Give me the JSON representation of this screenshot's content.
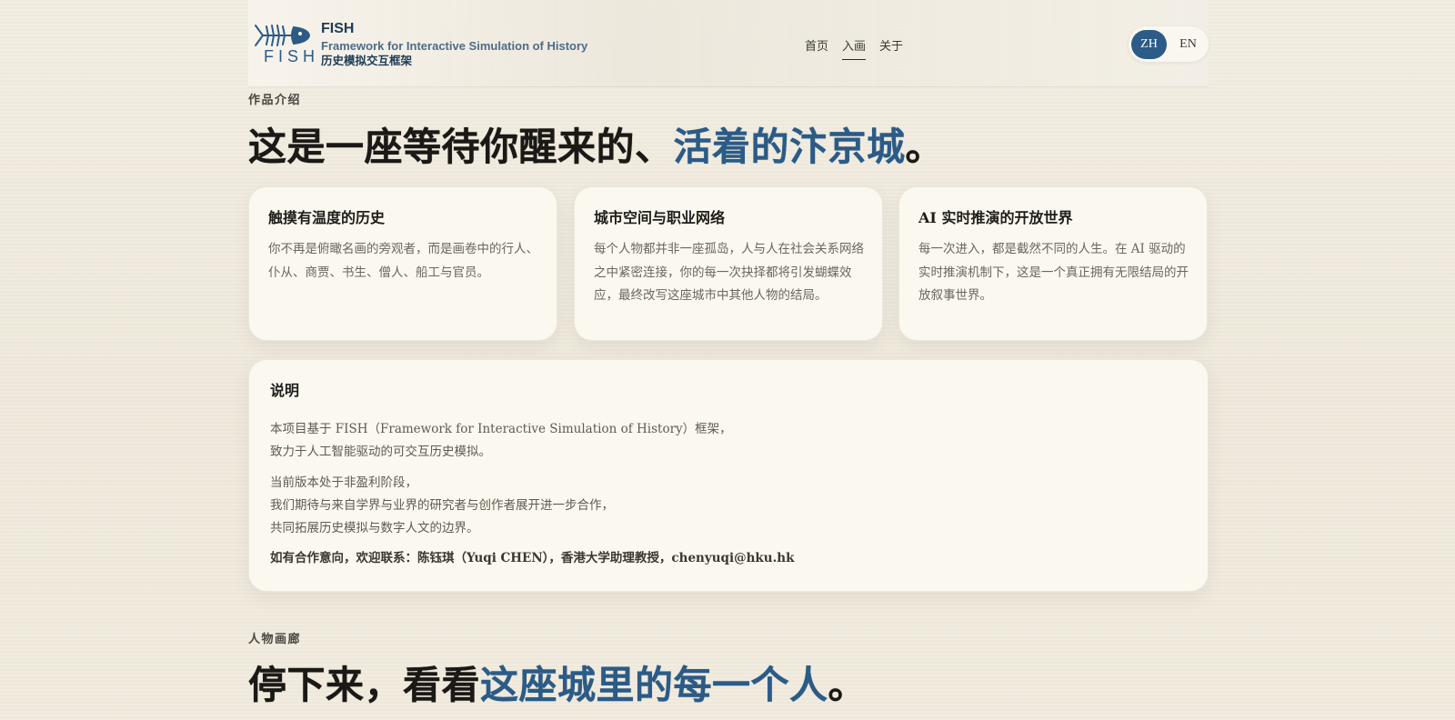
{
  "header": {
    "logo_text": "FISH",
    "brand_name": "FISH",
    "brand_subtitle": "Framework for Interactive Simulation of History",
    "brand_subtitle_cn": "历史模拟交互框架",
    "nav": [
      {
        "label": "首页",
        "active": false
      },
      {
        "label": "入画",
        "active": true
      },
      {
        "label": "关于",
        "active": false
      }
    ],
    "lang": {
      "zh": "ZH",
      "en": "EN",
      "selected": "ZH"
    }
  },
  "intro": {
    "section_label": "作品介绍",
    "headline_main": "这是一座等待你醒来的、",
    "headline_accent": "活着的汴京城",
    "headline_end": "。"
  },
  "cards": [
    {
      "title": "触摸有温度的历史",
      "text": "你不再是俯瞰名画的旁观者，而是画卷中的行人、仆从、商贾、书生、僧人、船工与官员。"
    },
    {
      "title": "城市空间与职业网络",
      "text": "每个人物都并非一座孤岛，人与人在社会关系网络之中紧密连接，你的每一次抉择都将引发蝴蝶效应，最终改写这座城市中其他人物的结局。"
    },
    {
      "title": "AI 实时推演的开放世界",
      "text": "每一次进入，都是截然不同的人生。在 AI 驱动的实时推演机制下，这是一个真正拥有无限结局的开放叙事世界。"
    }
  ],
  "note": {
    "title": "说明",
    "para1": [
      "本项目基于 FISH（Framework for Interactive Simulation of History）框架，",
      "致力于人工智能驱动的可交互历史模拟。"
    ],
    "para2": [
      "当前版本处于非盈利阶段，",
      "我们期待与来自学界与业界的研究者与创作者展开进一步合作，",
      "共同拓展历史模拟与数字人文的边界。"
    ],
    "contact": "如有合作意向，欢迎联系：陈钰琪（Yuqi CHEN），香港大学助理教授，chenyuqi@hku.hk"
  },
  "gallery": {
    "section_label": "人物画廊",
    "headline_main": "停下来，看看",
    "headline_accent": "这座城里的每一个人",
    "headline_end": "。"
  },
  "colors": {
    "accent": "#2b5b86",
    "background": "#f0eadd",
    "card": "#fbf8ef",
    "heading": "#1b1916"
  },
  "icons": {
    "logo": "fish-skeleton-icon"
  }
}
